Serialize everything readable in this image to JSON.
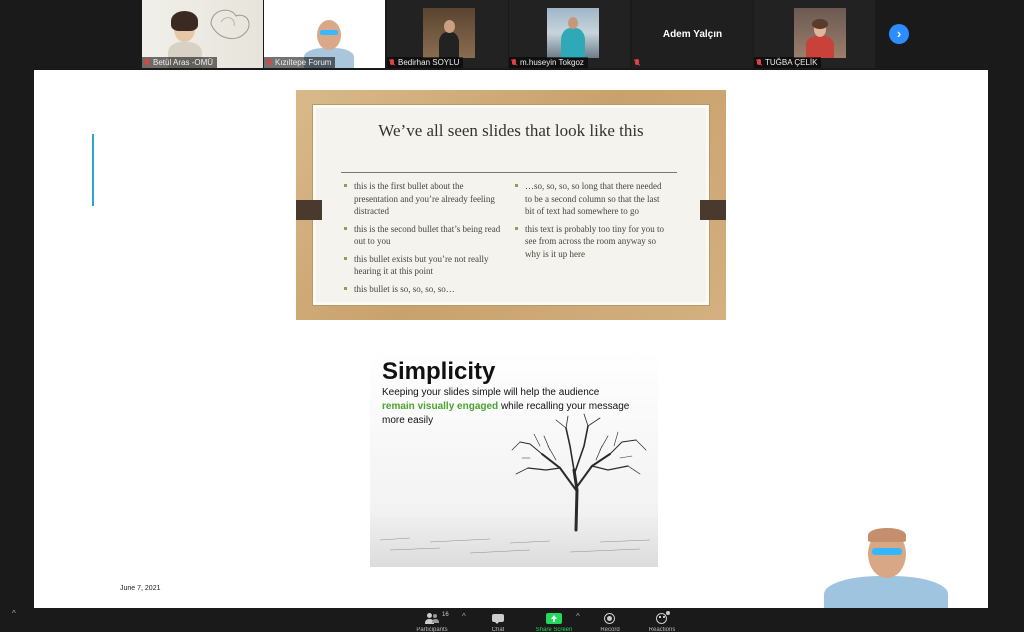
{
  "gallery": {
    "participants": [
      {
        "name": "Betül Aras -OMÜ",
        "muted": true
      },
      {
        "name": "Kızıltepe Forum",
        "muted": true,
        "active": true
      },
      {
        "name": "Bedirhan SOYLU",
        "muted": true
      },
      {
        "name": "m.huseyin Tokgoz",
        "muted": true
      },
      {
        "name": "Adem Yalçın",
        "muted": true,
        "video_off": true
      },
      {
        "name": "TUĞBA ÇELİK",
        "muted": true
      }
    ],
    "next_icon": "chevron-right-icon"
  },
  "slide1": {
    "title": "We’ve all seen slides that look like this",
    "left_bullets": [
      "this is the first bullet about the presentation and you’re already feeling distracted",
      "this is the second bullet that’s being read out to you",
      "this bullet exists but you’re not really hearing it at this point",
      "this bullet is so, so, so, so…"
    ],
    "right_bullets": [
      "…so, so, so, so long that there needed to be a second column so that the last bit of text had somewhere to go",
      "this text is probably too tiny for you to see from across the room anyway so why is it up here"
    ]
  },
  "slide2": {
    "title": "Simplicity",
    "body_before": "Keeping your slides simple will help the audience",
    "body_highlight": "remain visually engaged",
    "body_after": "while recalling your message more easily",
    "highlight_color": "#4aa32b"
  },
  "slide_date": "June 7, 2021",
  "toolbar": {
    "participants_count": "16",
    "buttons": [
      {
        "id": "participants",
        "icon": "participants-icon",
        "label": "Participants"
      },
      {
        "id": "chat",
        "icon": "chat-icon",
        "label": "Chat"
      },
      {
        "id": "share",
        "icon": "share-screen-icon",
        "label": "Share Screen"
      },
      {
        "id": "record",
        "icon": "record-icon",
        "label": "Record"
      },
      {
        "id": "reactions",
        "icon": "reactions-icon",
        "label": "Reactions"
      }
    ]
  },
  "colors": {
    "share_accent": "#2aa6d6",
    "share_button": "#23d959",
    "next_button": "#2d8cff",
    "muted_mic": "#e04242"
  }
}
